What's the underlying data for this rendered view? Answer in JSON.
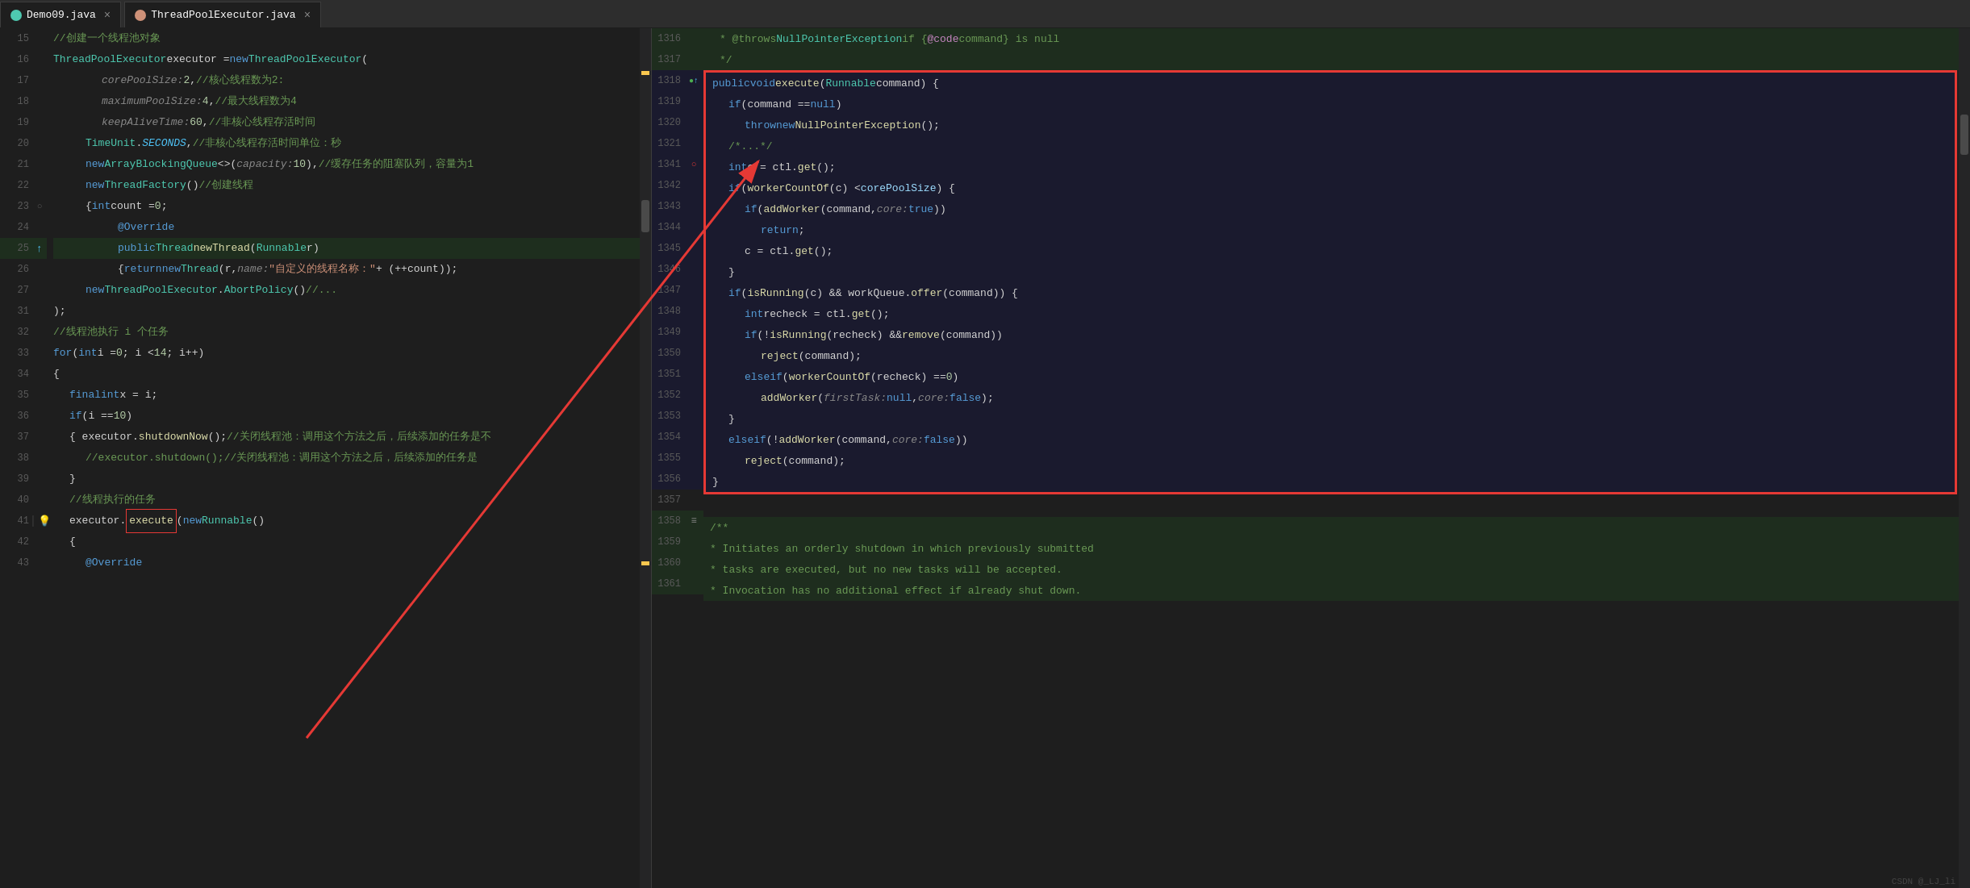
{
  "tabs": {
    "left": {
      "label": "Demo09.java",
      "icon": "java-icon",
      "active": true
    },
    "right": {
      "label": "ThreadPoolExecutor.java",
      "icon": "java-icon",
      "active": true
    }
  },
  "left_lines": [
    {
      "num": 15,
      "code": "//创建一个线程池对象",
      "type": "comment"
    },
    {
      "num": 16,
      "code": "ThreadPoolExecutor executor = new ThreadPoolExecutor(",
      "type": "code"
    },
    {
      "num": 17,
      "code": "    corePoolSize: 2,     //核心线程数为2:",
      "type": "code"
    },
    {
      "num": 18,
      "code": "    maximumPoolSize: 4,  //最大线程数为4",
      "type": "code"
    },
    {
      "num": 19,
      "code": "    keepAliveTime: 60,   //非核心线程存活时间",
      "type": "code"
    },
    {
      "num": 20,
      "code": "    TimeUnit.SECONDS,    //非核心线程存活时间单位：秒",
      "type": "code"
    },
    {
      "num": 21,
      "code": "    new ArrayBlockingQueue<>( capacity: 10),  //缓存任务的阻塞队列，容量为1",
      "type": "code"
    },
    {
      "num": 22,
      "code": "    new ThreadFactory()  //创建线程",
      "type": "code"
    },
    {
      "num": 23,
      "code": "    {int count = 0;",
      "type": "code"
    },
    {
      "num": 24,
      "code": "         @Override",
      "type": "code"
    },
    {
      "num": 25,
      "code": "         public Thread newThread(Runnable r)",
      "type": "code"
    },
    {
      "num": 26,
      "code": "         { return new Thread(r, name: \"自定义的线程名称：\" + (++count));",
      "type": "code"
    },
    {
      "num": 27,
      "code": "    new ThreadPoolExecutor.AbortPolicy() //...",
      "type": "code"
    },
    {
      "num": 31,
      "code": ");",
      "type": "code"
    },
    {
      "num": 32,
      "code": "//线程池执行 i 个任务",
      "type": "comment"
    },
    {
      "num": 33,
      "code": "for (int i = 0; i < 14; i++)",
      "type": "code"
    },
    {
      "num": 34,
      "code": "{",
      "type": "code"
    },
    {
      "num": 35,
      "code": "    final int x = i;",
      "type": "code"
    },
    {
      "num": 36,
      "code": "    if (i == 10)",
      "type": "code"
    },
    {
      "num": 37,
      "code": "    { executor.shutdownNow();//关闭线程池：调用这个方法之后，后续添加的任务是不",
      "type": "code"
    },
    {
      "num": 38,
      "code": "        //executor.shutdown();//关闭线程池：调用这个方法之后，后续添加的任务是",
      "type": "comment"
    },
    {
      "num": 39,
      "code": "    }",
      "type": "code"
    },
    {
      "num": 40,
      "code": "    //线程执行的任务",
      "type": "comment"
    },
    {
      "num": 41,
      "code": "    executor.execute(new Runnable()",
      "type": "code"
    },
    {
      "num": 42,
      "code": "    {",
      "type": "code"
    },
    {
      "num": 43,
      "code": "         @Override",
      "type": "code"
    }
  ],
  "right_lines_top": [
    {
      "num": 1316,
      "code": " * @throws NullPointerException if {@code command} is null"
    },
    {
      "num": 1317,
      "code": " */"
    }
  ],
  "right_highlighted": [
    {
      "num": 1318,
      "code": "public void execute(Runnable command) {"
    },
    {
      "num": 1319,
      "code": "    if (command == null)"
    },
    {
      "num": 1320,
      "code": "        throw new NullPointerException();"
    },
    {
      "num": 1321,
      "code": "    /*...*/"
    },
    {
      "num": 1341,
      "code": "    int c = ctl.get();"
    },
    {
      "num": 1342,
      "code": "    if (workerCountOf(c) < corePoolSize) {"
    },
    {
      "num": 1343,
      "code": "        if (addWorker(command,  core: true))"
    },
    {
      "num": 1344,
      "code": "            return;"
    },
    {
      "num": 1345,
      "code": "        c = ctl.get();"
    },
    {
      "num": 1346,
      "code": "    }"
    },
    {
      "num": 1347,
      "code": "    if (isRunning(c) && workQueue.offer(command)) {"
    },
    {
      "num": 1348,
      "code": "        int recheck = ctl.get();"
    },
    {
      "num": 1349,
      "code": "        if (! isRunning(recheck) && remove(command))"
    },
    {
      "num": 1350,
      "code": "            reject(command);"
    },
    {
      "num": 1351,
      "code": "        else if (workerCountOf(recheck) == 0)"
    },
    {
      "num": 1352,
      "code": "            addWorker( firstTask: null,  core: false);"
    },
    {
      "num": 1353,
      "code": "    }"
    },
    {
      "num": 1354,
      "code": "    else if (!addWorker(command,  core: false))"
    },
    {
      "num": 1355,
      "code": "        reject(command);"
    },
    {
      "num": 1356,
      "code": "}"
    }
  ],
  "right_lines_bottom": [
    {
      "num": 1357,
      "code": ""
    },
    {
      "num": 1358,
      "code": "/**"
    },
    {
      "num": 1359,
      "code": " * Initiates an orderly shutdown in which previously submitted"
    },
    {
      "num": 1360,
      "code": " * tasks are executed, but no new tasks will be accepted."
    },
    {
      "num": 1361,
      "code": " * Invocation has no additional effect if already shut down."
    }
  ],
  "colors": {
    "background": "#1e1e1e",
    "tab_bar": "#2d2d2d",
    "gutter": "#1e1e1e",
    "line_num": "#5a5a5a",
    "keyword_blue": "#569cd6",
    "keyword_purple": "#c586c0",
    "type_teal": "#4ec9b0",
    "string": "#ce9178",
    "comment": "#6a9955",
    "number": "#b5cea8",
    "function": "#dcdcaa",
    "parameter": "#9cdcfe",
    "highlight_red": "#e53935",
    "highlight_bg": "#1a1a2e"
  }
}
